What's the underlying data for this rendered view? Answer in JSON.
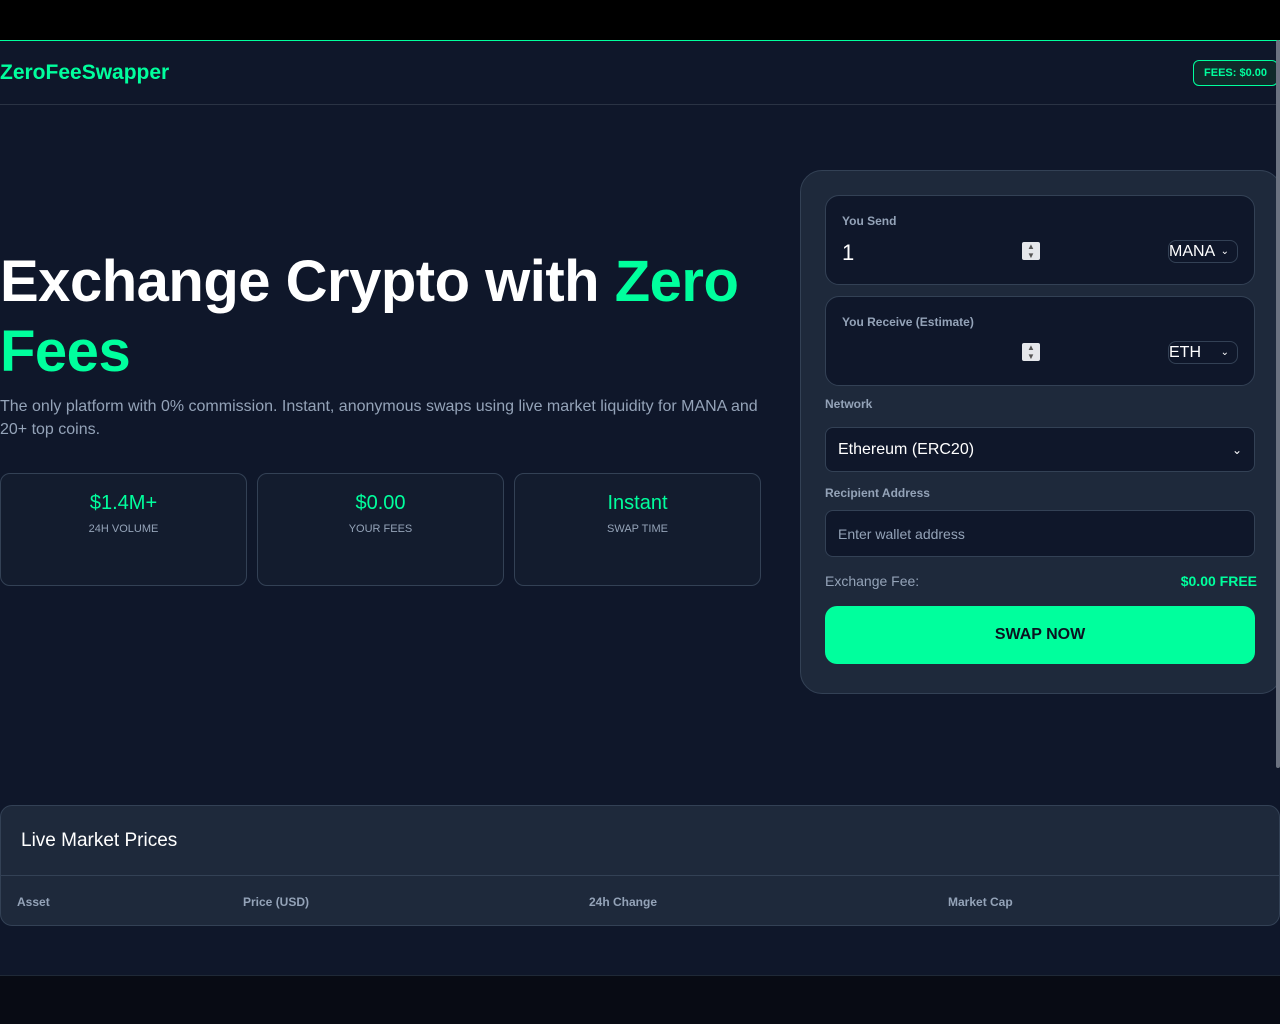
{
  "header": {
    "logo": "ZeroFeeSwapper",
    "fee_badge": "FEES: $0.00"
  },
  "hero": {
    "title_part1": "Exchange Crypto with ",
    "title_accent": "Zero Fees",
    "subtitle": "The only platform with 0% commission. Instant, anonymous swaps using live market liquidity for MANA and 20+ top coins."
  },
  "stats": [
    {
      "value": "$1.4M+",
      "label": "24H VOLUME"
    },
    {
      "value": "$0.00",
      "label": "YOUR FEES"
    },
    {
      "value": "Instant",
      "label": "SWAP TIME"
    }
  ],
  "swap": {
    "send_label": "You Send",
    "send_amount": "1",
    "send_coin": "MANA",
    "receive_label": "You Receive (Estimate)",
    "receive_amount": "",
    "receive_coin": "ETH",
    "network_label": "Network",
    "network_value": "Ethereum (ERC20)",
    "recipient_label": "Recipient Address",
    "recipient_placeholder": "Enter wallet address",
    "fee_label": "Exchange Fee:",
    "fee_value": "$0.00 FREE",
    "button": "SWAP NOW"
  },
  "market": {
    "title": "Live Market Prices",
    "columns": [
      "Asset",
      "Price (USD)",
      "24h Change",
      "Market Cap"
    ]
  },
  "colors": {
    "accent": "#00ff9d",
    "background": "#0f172a",
    "card": "#1e293b"
  }
}
